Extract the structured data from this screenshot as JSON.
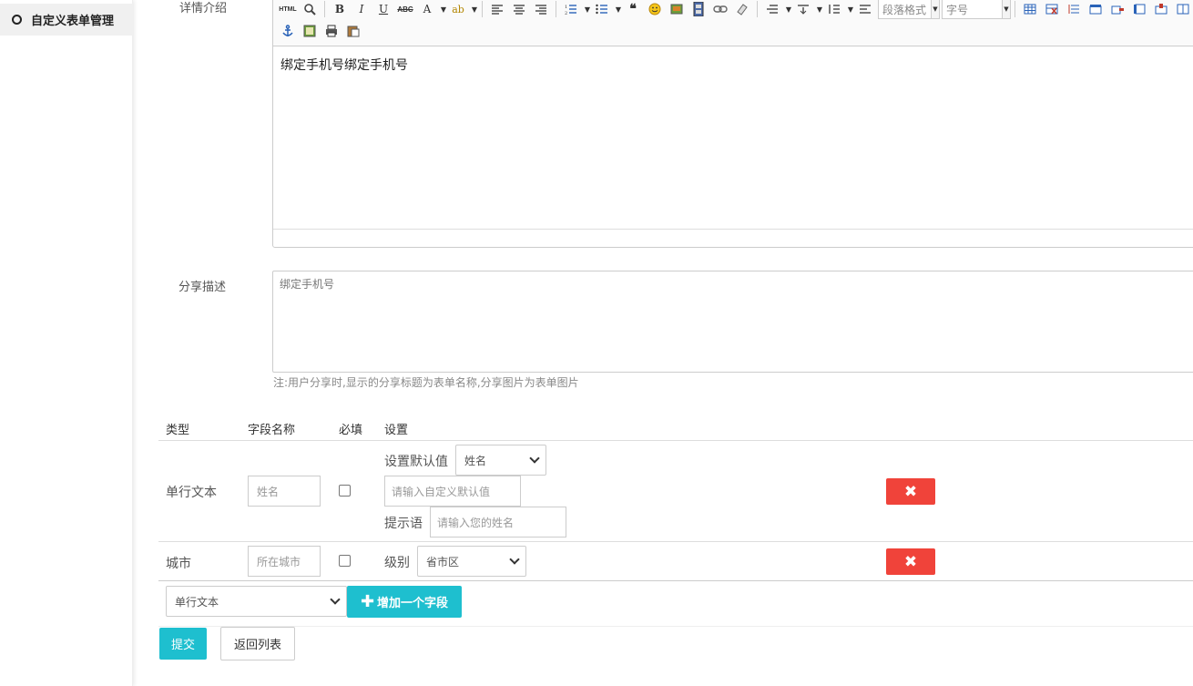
{
  "sidebar": {
    "active_item": "自定义表单管理"
  },
  "form": {
    "detail_label": "详情介绍",
    "editor_content": "绑定手机号绑定手机号",
    "toolbar": {
      "html_label": "HTML",
      "bold": "B",
      "italic": "I",
      "underline": "U",
      "strike": "ABC",
      "font_color": "A",
      "highlight": "ab",
      "paragraph_select": "段落格式",
      "size_select": "字号"
    },
    "share_label": "分享描述",
    "share_value": "绑定手机号",
    "share_note": "注:用户分享时,显示的分享标题为表单名称,分享图片为表单图片"
  },
  "fields_table": {
    "headers": [
      "类型",
      "字段名称",
      "必填",
      "设置"
    ],
    "rows": [
      {
        "type": "单行文本",
        "name_placeholder": "姓名",
        "default_label": "设置默认值",
        "default_select": "姓名",
        "custom_default_placeholder": "请输入自定义默认值",
        "hint_label": "提示语",
        "hint_placeholder": "请输入您的姓名",
        "delete_icon": "✖"
      },
      {
        "type": "城市",
        "name_placeholder": "所在城市",
        "level_label": "级别",
        "level_select": "省市区",
        "delete_icon": "✖"
      }
    ],
    "new_field_type": "单行文本",
    "add_field_label": "增加一个字段"
  },
  "actions": {
    "submit": "提交",
    "back": "返回列表"
  },
  "colors": {
    "accent": "#1ebfcf",
    "danger": "#f0433a"
  }
}
